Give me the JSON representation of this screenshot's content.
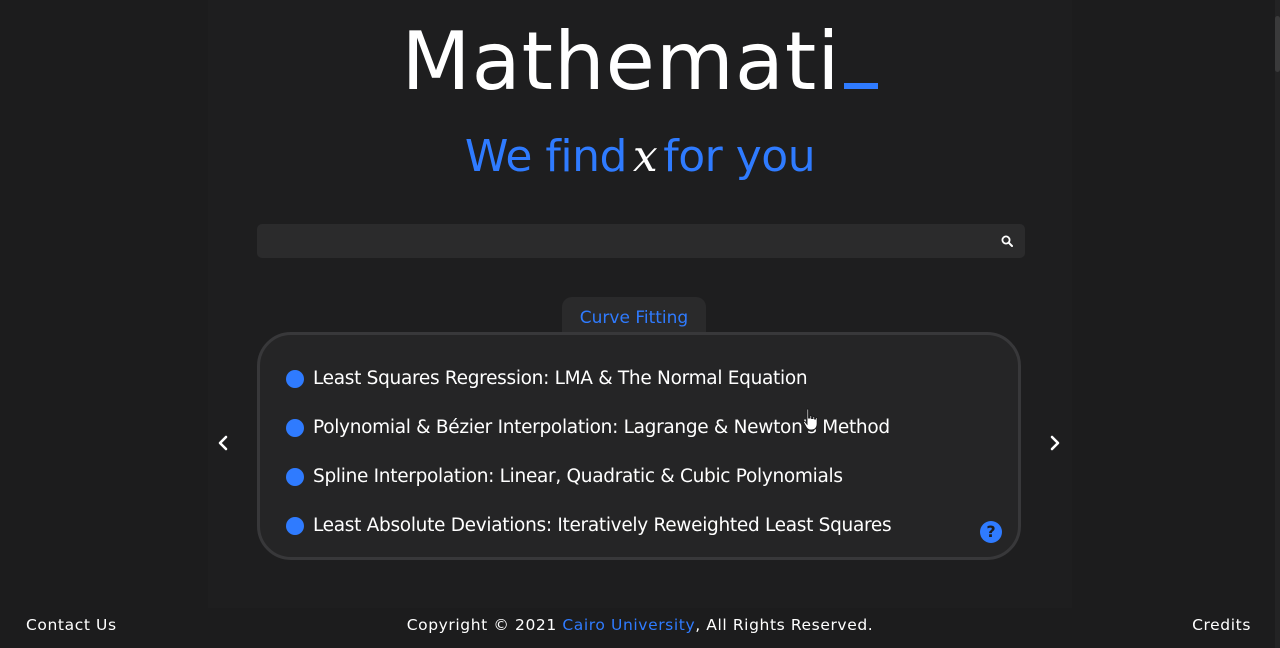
{
  "header": {
    "logo_text": "Mathemati",
    "tagline_before": "We find",
    "tagline_var": "x",
    "tagline_after": "for you"
  },
  "search": {
    "value": "",
    "placeholder": "",
    "icon": "search-icon"
  },
  "carousel": {
    "active_tab": "Curve Fitting",
    "topics": [
      {
        "label": "Least Squares Regression: LMA & The Normal Equation"
      },
      {
        "label": "Polynomial & Bézier Interpolation: Lagrange & Newton's Method"
      },
      {
        "label": "Spline Interpolation: Linear, Quadratic & Cubic Polynomials"
      },
      {
        "label": "Least Absolute Deviations: Iteratively Reweighted Least Squares"
      }
    ],
    "prev_icon": "chevron-left-icon",
    "next_icon": "chevron-right-icon",
    "help_icon": "question-circle-icon",
    "help_glyph": "?"
  },
  "footer": {
    "contact_label": "Contact Us",
    "copyright_prefix": "Copyright © 2021",
    "copyright_link": "Cairo University",
    "copyright_suffix": ",  All Rights Reserved.",
    "credits_label": "Credits"
  },
  "colors": {
    "accent": "#2f7bff",
    "background": "#1c1c1d",
    "card": "#252526",
    "text": "#ffffff"
  }
}
